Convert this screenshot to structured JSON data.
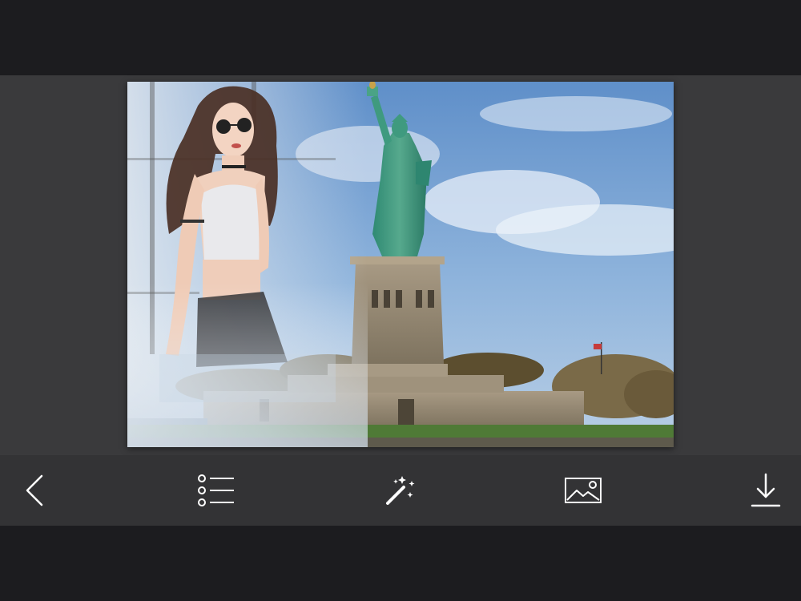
{
  "screen": {
    "background": "#1c1c1f",
    "canvas_background": "#3a3a3c",
    "toolbar_background": "#333335",
    "icon_color": "#ffffff"
  },
  "photo": {
    "description_icon": "photo-frame-image"
  },
  "toolbar": {
    "items": [
      {
        "name": "back-button",
        "icon": "chevron-left-icon"
      },
      {
        "name": "list-button",
        "icon": "list-icon"
      },
      {
        "name": "effects-button",
        "icon": "magic-wand-icon"
      },
      {
        "name": "gallery-button",
        "icon": "image-icon"
      },
      {
        "name": "download-button",
        "icon": "download-icon"
      }
    ]
  }
}
